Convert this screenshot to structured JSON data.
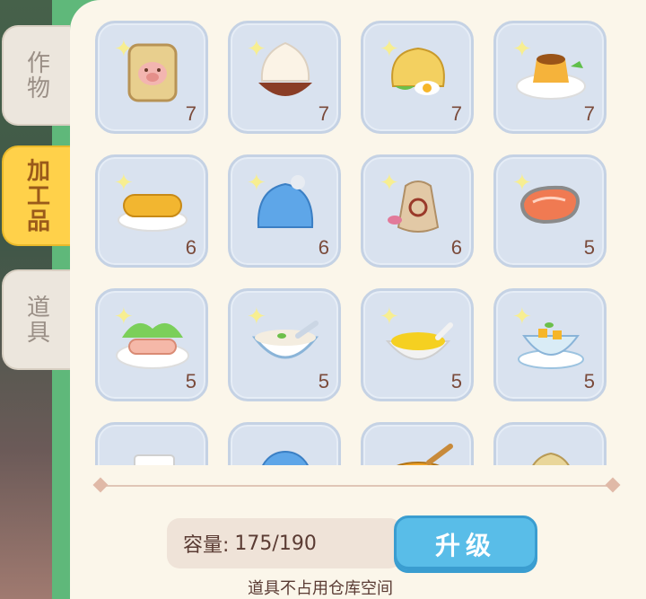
{
  "tabs": [
    {
      "label": "作物",
      "active": false
    },
    {
      "label": "加工品",
      "active": true
    },
    {
      "label": "道具",
      "active": false
    }
  ],
  "items": [
    {
      "icon": "flour-sack-icon",
      "count": "7"
    },
    {
      "icon": "steamed-bun-icon",
      "count": "7"
    },
    {
      "icon": "pancake-wrap-icon",
      "count": "7"
    },
    {
      "icon": "pudding-icon",
      "count": "7"
    },
    {
      "icon": "bread-loaf-icon",
      "count": "6"
    },
    {
      "icon": "knit-hat-icon",
      "count": "6"
    },
    {
      "icon": "spice-bag-icon",
      "count": "6"
    },
    {
      "icon": "salmon-steak-icon",
      "count": "5"
    },
    {
      "icon": "meat-rolls-icon",
      "count": "5"
    },
    {
      "icon": "porridge-icon",
      "count": "5"
    },
    {
      "icon": "custard-bowl-icon",
      "count": "5"
    },
    {
      "icon": "mango-dessert-icon",
      "count": "5"
    },
    {
      "icon": "tofu-icon",
      "count": ""
    },
    {
      "icon": "yarn-ball-icon",
      "count": ""
    },
    {
      "icon": "honey-bowl-icon",
      "count": ""
    },
    {
      "icon": "dumpling-icon",
      "count": ""
    }
  ],
  "capacity": {
    "label": "容量:",
    "value": "175/190"
  },
  "upgrade_label": "升级",
  "note": "道具不占用仓库空间"
}
